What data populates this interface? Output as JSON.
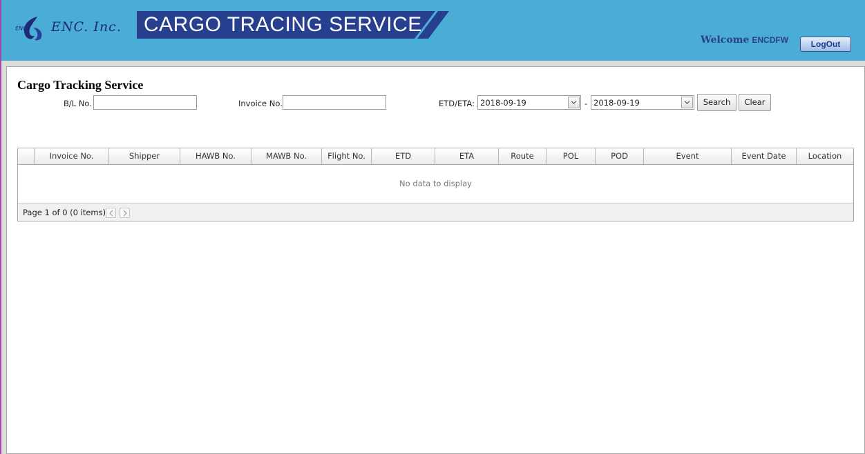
{
  "header": {
    "logo_text": "ENC. Inc.",
    "logo_mark_text": "ENC",
    "banner_title": "CARGO TRACING SERVICE",
    "welcome_label": "Welcome",
    "username": "ENCDFW",
    "logout_label": "LogOut"
  },
  "page": {
    "title": "Cargo Tracking Service"
  },
  "filters": {
    "bl_label": "B/L No.",
    "bl_value": "",
    "invoice_label": "Invoice No.",
    "invoice_value": "",
    "etd_eta_label": "ETD/ETA:",
    "date_from": "2018-09-19",
    "date_separator": "-",
    "date_to": "2018-09-19",
    "search_label": "Search",
    "clear_label": "Clear"
  },
  "grid": {
    "columns": [
      "",
      "Invoice No.",
      "Shipper",
      "HAWB No.",
      "MAWB No.",
      "Flight No.",
      "ETD",
      "ETA",
      "Route",
      "POL",
      "POD",
      "Event",
      "Event Date",
      "Location"
    ],
    "empty_message": "No data to display",
    "pager_summary": "Page 1 of 0 (0 items)"
  },
  "colors": {
    "header_bg": "#4badd6",
    "banner_bg": "#263f8f",
    "title_navy": "#1d2a78"
  }
}
